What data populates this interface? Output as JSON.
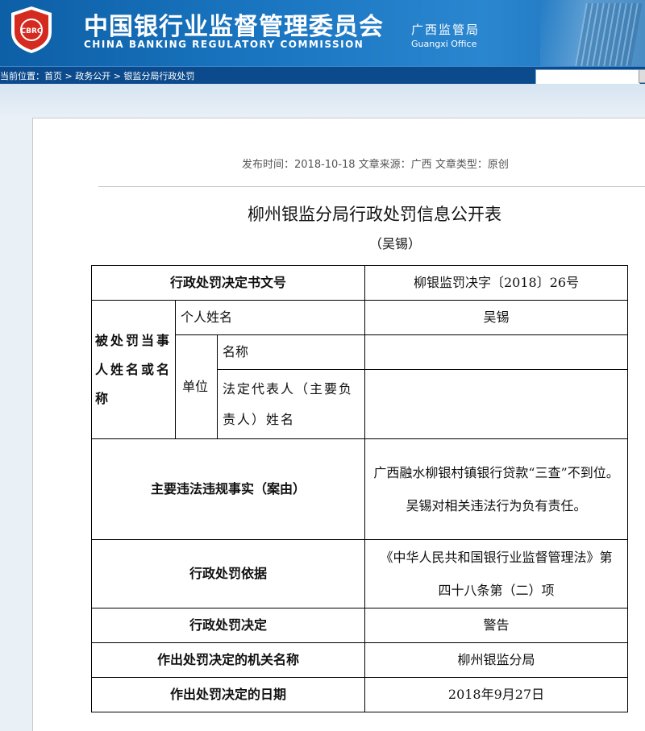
{
  "header": {
    "title_cn": "中国银行业监督管理委员会",
    "title_en": "CHINA BANKING REGULATORY COMMISSION",
    "office_cn": "广西监管局",
    "office_en": "Guangxi Office",
    "logo_text": "CBRC"
  },
  "nav": {
    "breadcrumb": "当前位置：首页 > 政务公开 > 银监分局行政处罚",
    "search_value": ""
  },
  "article": {
    "meta": "发布时间：2018-10-18   文章来源：广西   文章类型：原创",
    "title": "柳州银监分局行政处罚信息公开表",
    "subtitle": "（吴锡）"
  },
  "table": {
    "r1_label": "行政处罚决定书文号",
    "r1_value": "柳银监罚决字〔2018〕26号",
    "party_label": "被处罚当事人姓名或名称",
    "person_label": "个人姓名",
    "person_value": "吴锡",
    "unit_label": "单位",
    "name_label": "名称",
    "name_value": "",
    "rep_label": "法定代表人（主要负责人）姓名",
    "rep_value": "",
    "facts_label": "主要违法违规事实（案由）",
    "facts_value": "广西融水柳银村镇银行贷款“三查”不到位。吴锡对相关违法行为负有责任。",
    "basis_label": "行政处罚依据",
    "basis_value": "《中华人民共和国银行业监督管理法》第四十八条第（二）项",
    "decision_label": "行政处罚决定",
    "decision_value": "警告",
    "authority_label": "作出处罚决定的机关名称",
    "authority_value": "柳州银监分局",
    "date_label": "作出处罚决定的日期",
    "date_value": "2018年9月27日"
  }
}
